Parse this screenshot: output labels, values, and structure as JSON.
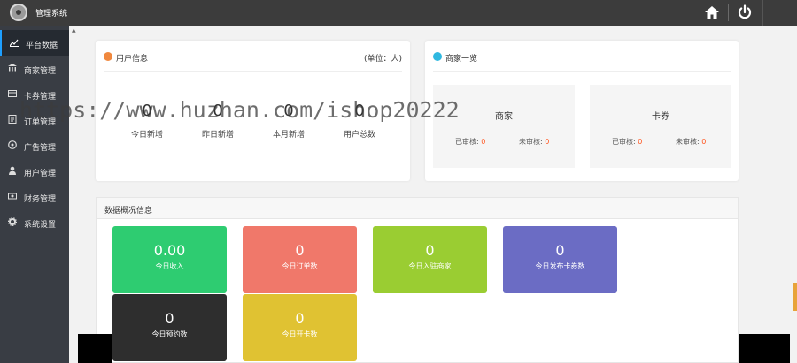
{
  "header": {
    "title": "管理系统",
    "home_icon": "home-icon",
    "power_icon": "power-icon"
  },
  "sidebar": {
    "items": [
      {
        "label": "平台数据",
        "icon": "chart-icon",
        "active": true
      },
      {
        "label": "商家管理",
        "icon": "bank-icon"
      },
      {
        "label": "卡券管理",
        "icon": "card-icon"
      },
      {
        "label": "订单管理",
        "icon": "order-icon"
      },
      {
        "label": "广告管理",
        "icon": "ad-icon"
      },
      {
        "label": "用户管理",
        "icon": "user-icon"
      },
      {
        "label": "财务管理",
        "icon": "finance-icon"
      },
      {
        "label": "系统设置",
        "icon": "gear-icon"
      }
    ]
  },
  "user_info": {
    "title": "用户信息",
    "unit": "(单位：人)",
    "stats": [
      {
        "value": "0",
        "label": "今日新增"
      },
      {
        "value": "0",
        "label": "昨日新增"
      },
      {
        "value": "0",
        "label": "本月新增"
      },
      {
        "value": "0",
        "label": "用户总数"
      }
    ]
  },
  "merchant_overview": {
    "title": "商家一览",
    "boxes": [
      {
        "title": "商家",
        "approved_label": "已审核:",
        "approved": "0",
        "pending_label": "未审核:",
        "pending": "0"
      },
      {
        "title": "卡券",
        "approved_label": "已审核:",
        "approved": "0",
        "pending_label": "未审核:",
        "pending": "0"
      }
    ]
  },
  "data_overview": {
    "title": "数据概况信息",
    "tiles": [
      {
        "value": "0.00",
        "label": "今日收入",
        "color": "#2ecc71"
      },
      {
        "value": "0",
        "label": "今日订单数",
        "color": "#f0786a"
      },
      {
        "value": "0",
        "label": "今日入驻商家",
        "color": "#9acd32"
      },
      {
        "value": "0",
        "label": "今日发布卡券数",
        "color": "#6b6cc4"
      },
      {
        "value": "0",
        "label": "今日预约数",
        "color": "#2e2e2e"
      },
      {
        "value": "0",
        "label": "今日开卡数",
        "color": "#e0c232"
      }
    ]
  },
  "watermark": "https://www.huzhan.com/ishop20222",
  "colors": {
    "accent": "#1e9fff",
    "highlight": "#ff5722",
    "sidebar": "#393d44",
    "topbar": "#3c3c3c"
  }
}
